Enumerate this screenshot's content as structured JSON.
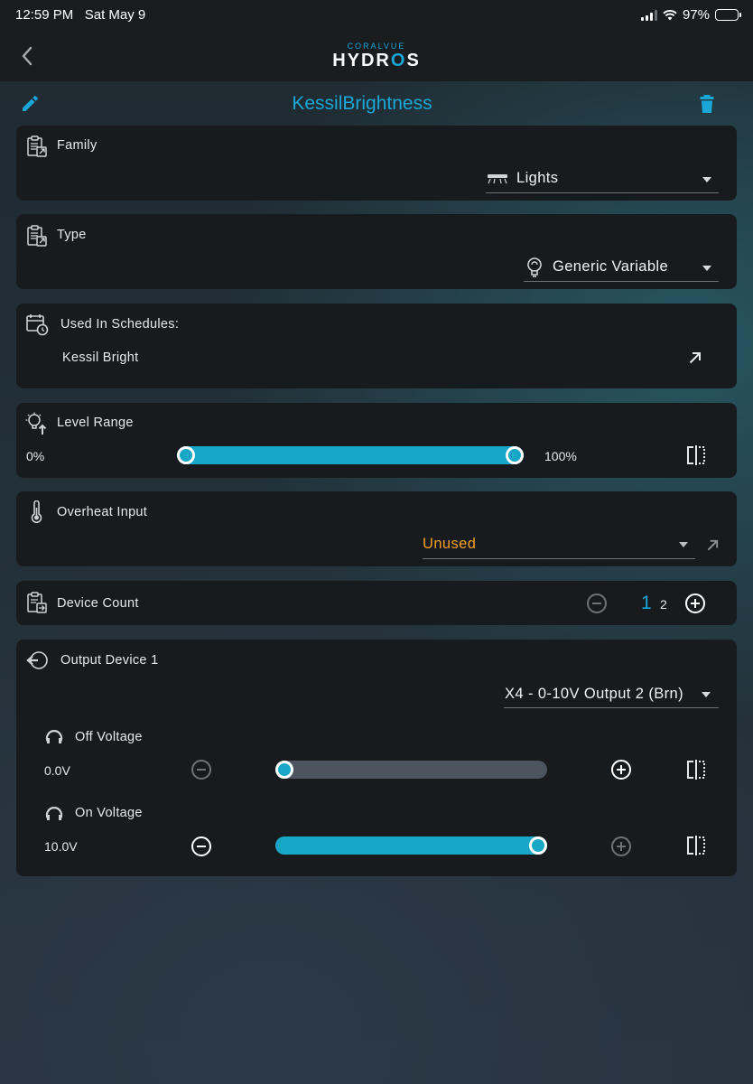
{
  "status_bar": {
    "time": "12:59 PM",
    "date": "Sat May 9",
    "battery": "97%"
  },
  "nav": {
    "back_icon": "chevron-left-icon",
    "logo_top": "CORALVUE",
    "logo_main_pre": "HYDR",
    "logo_main_o": "O",
    "logo_main_post": "S"
  },
  "header": {
    "title": "KessilBrightness",
    "edit_icon": "pencil-icon",
    "delete_icon": "trash-icon"
  },
  "family": {
    "label": "Family",
    "value": "Lights"
  },
  "type": {
    "label": "Type",
    "value": "Generic Variable"
  },
  "schedules": {
    "label": "Used In Schedules:",
    "item": "Kessil Bright"
  },
  "level_range": {
    "label": "Level Range",
    "min_label": "0%",
    "max_label": "100%",
    "low_value": 0,
    "high_value": 100
  },
  "overheat": {
    "label": "Overheat Input",
    "value": "Unused"
  },
  "device_count": {
    "label": "Device Count",
    "selected": "1",
    "other": "2"
  },
  "output_device": {
    "label": "Output Device 1",
    "value": "X4 - 0-10V Output 2 (Brn)",
    "off_voltage": {
      "label": "Off Voltage",
      "value": "0.0V",
      "fraction": 0.0
    },
    "on_voltage": {
      "label": "On Voltage",
      "value": "10.0V",
      "fraction": 1.0
    }
  },
  "colors": {
    "accent": "#19a7d8",
    "warning": "#f0a020",
    "card": "#181b1e",
    "track_inactive": "#4c555d"
  }
}
